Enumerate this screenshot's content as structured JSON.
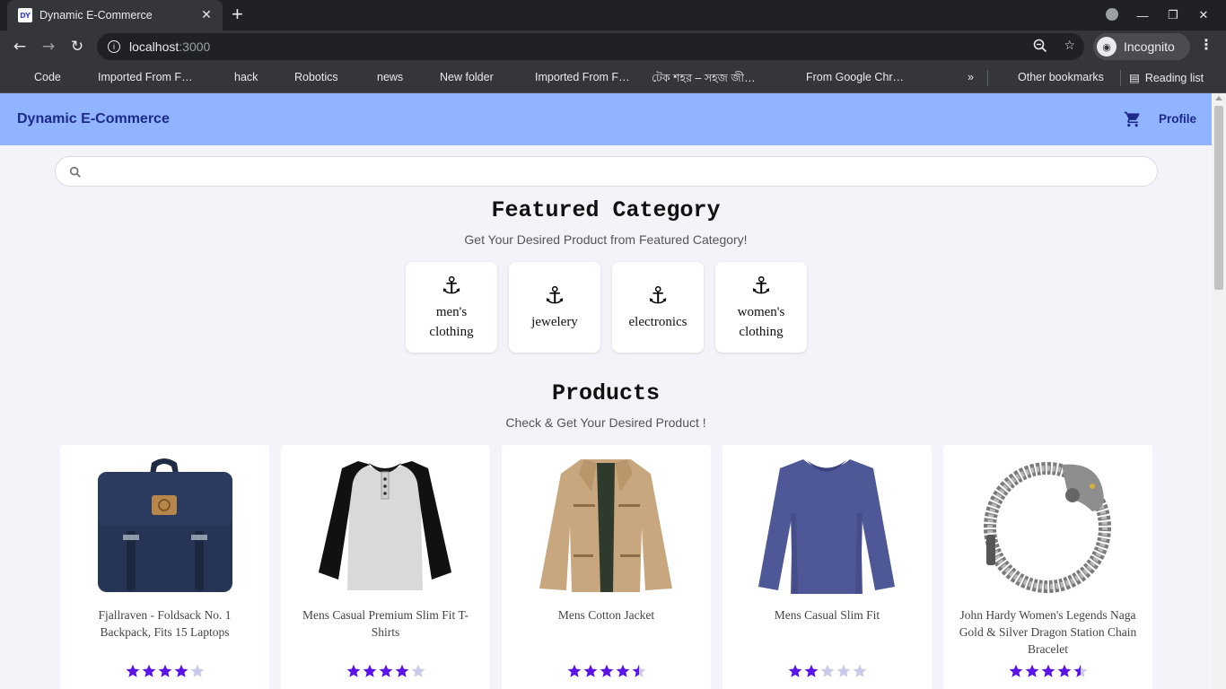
{
  "browser": {
    "tab_title": "Dynamic E-Commerce",
    "tab_favicon_text": "DY",
    "new_tab_label": "+",
    "url_host": "localhost",
    "url_port": ":3000",
    "incognito_label": "Incognito",
    "bookmarks": [
      "Code",
      "Imported From F…",
      "hack",
      "Robotics",
      "news",
      "New folder",
      "Imported From F…",
      "টেক শহর – সহজ জী…",
      "From Google Chr…"
    ],
    "bookmarks_overflow": "»",
    "other_bookmarks": "Other bookmarks",
    "reading_list": "Reading list"
  },
  "app": {
    "brand": "Dynamic E-Commerce",
    "profile_label": "Profile",
    "search_placeholder": ""
  },
  "featured": {
    "title": "Featured Category",
    "subtitle": "Get Your Desired Product from Featured Category!",
    "categories": [
      {
        "label": "men's clothing",
        "icon": "anchor-icon"
      },
      {
        "label": "jewelery",
        "icon": "anchor-icon"
      },
      {
        "label": "electronics",
        "icon": "anchor-icon"
      },
      {
        "label": "women's clothing",
        "icon": "anchor-icon"
      }
    ]
  },
  "products_section": {
    "title": "Products",
    "subtitle": "Check & Get Your Desired Product !",
    "items": [
      {
        "title": "Fjallraven - Foldsack No. 1 Backpack, Fits 15 Laptops",
        "rating": 4,
        "image": "navy-backpack"
      },
      {
        "title": "Mens Casual Premium Slim Fit T-Shirts",
        "rating": 4,
        "image": "raglan-tshirt"
      },
      {
        "title": "Mens Cotton Jacket",
        "rating": 4.5,
        "image": "khaki-jacket"
      },
      {
        "title": "Mens Casual Slim Fit",
        "rating": 2,
        "image": "blue-longsleeve"
      },
      {
        "title": "John Hardy Women's Legends Naga Gold & Silver Dragon Station Chain Bracelet",
        "rating": 4.5,
        "image": "dragon-bracelet"
      }
    ]
  },
  "colors": {
    "appbar": "#90b4ff",
    "brand_text": "#1e2a8a",
    "star_filled": "#5b14e6",
    "star_empty": "#c9c9e8"
  }
}
